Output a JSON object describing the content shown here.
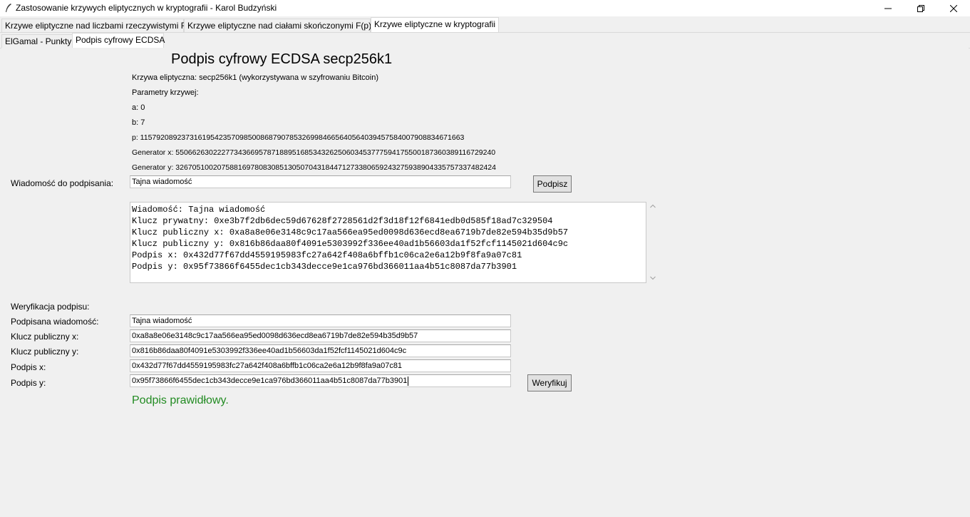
{
  "window": {
    "title": "Zastosowanie krzywych eliptycznych w kryptografii - Karol Budzyński"
  },
  "tabs_main": [
    "Krzywe eliptyczne nad liczbami rzeczywistymi R",
    "Krzywe eliptyczne nad ciałami skończonymi F(p)",
    "Krzywe eliptyczne w kryptografii"
  ],
  "tabs_sub": [
    "ElGamal - Punkty",
    "Podpis cyfrowy ECDSA"
  ],
  "heading": "Podpis cyfrowy ECDSA secp256k1",
  "curve_info": [
    "Krzywa eliptyczna: secp256k1 (wykorzystywana w szyfrowaniu Bitcoin)",
    "Parametry krzywej:",
    "a: 0",
    "b: 7",
    "p: 115792089237316195423570985008687907853269984665640564039457584007908834671663",
    "Generator x: 55066263022277343669578718895168534326250603453777594175500187360389116729240",
    "Generator y: 32670510020758816978083085130507043184471273380659243275938904335757337482424"
  ],
  "sign": {
    "message_label": "Wiadomość do podpisania:",
    "message_value": "Tajna wiadomość",
    "sign_button": "Podpisz"
  },
  "output_lines": [
    "Wiadomość: Tajna wiadomość",
    "Klucz prywatny: 0xe3b7f2db6dec59d67628f2728561d2f3d18f12f6841edb0d585f18ad7c329504",
    "Klucz publiczny x: 0xa8a8e06e3148c9c17aa566ea95ed0098d636ecd8ea6719b7de82e594b35d9b57",
    "Klucz publiczny y: 0x816b86daa80f4091e5303992f336ee40ad1b56603da1f52fcf1145021d604c9c",
    "Podpis x: 0x432d77f67dd4559195983fc27a642f408a6bffb1c06ca2e6a12b9f8fa9a07c81",
    "Podpis y: 0x95f73866f6455dec1cb343decce9e1ca976bd366011aa4b51c8087da77b3901"
  ],
  "verify": {
    "section_label": "Weryfikacja podpisu:",
    "fields": [
      {
        "label": "Podpisana wiadomość:",
        "value": "Tajna wiadomość"
      },
      {
        "label": "Klucz publiczny x:",
        "value": "0xa8a8e06e3148c9c17aa566ea95ed0098d636ecd8ea6719b7de82e594b35d9b57"
      },
      {
        "label": "Klucz publiczny y:",
        "value": "0x816b86daa80f4091e5303992f336ee40ad1b56603da1f52fcf1145021d604c9c"
      },
      {
        "label": "Podpis x:",
        "value": "0x432d77f67dd4559195983fc27a642f408a6bffb1c06ca2e6a12b9f8fa9a07c81"
      },
      {
        "label": "Podpis y:",
        "value": "0x95f73866f6455dec1cb343decce9e1ca976bd366011aa4b51c8087da77b3901"
      }
    ],
    "verify_button": "Weryfikuj",
    "result": "Podpis prawidłowy.",
    "result_color": "#228b22"
  }
}
